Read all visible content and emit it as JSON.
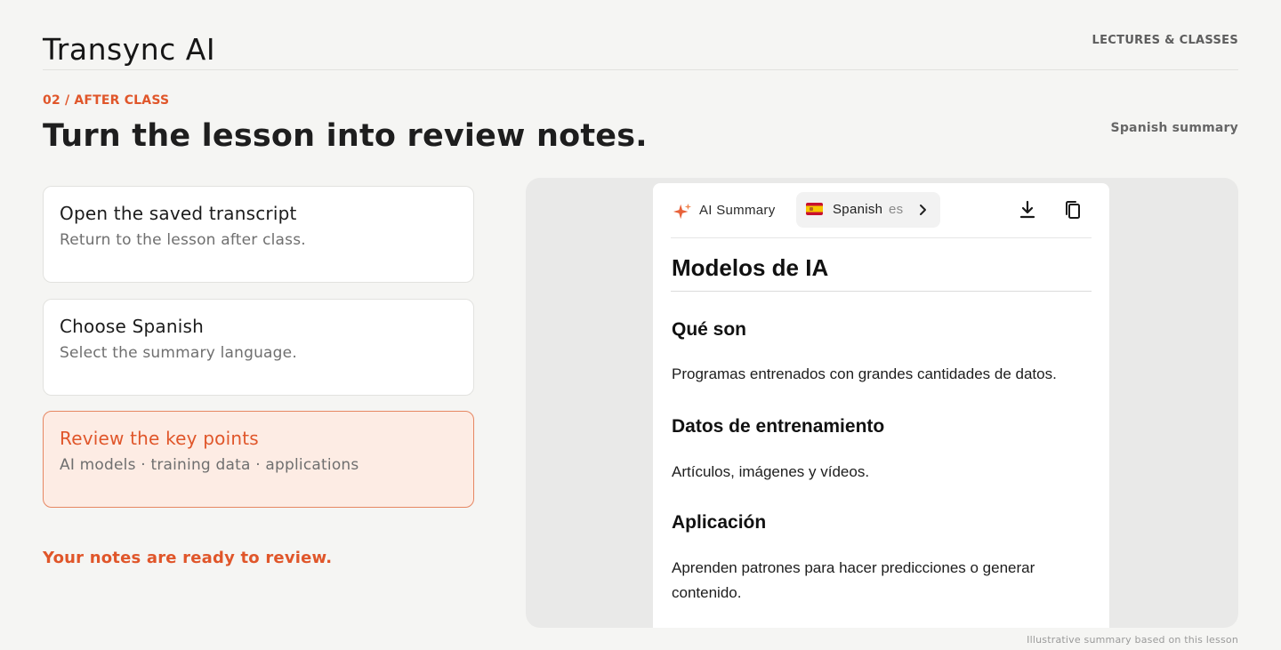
{
  "brand": {
    "name": "Transync AI"
  },
  "nav": {
    "label": "LECTURES & CLASSES"
  },
  "section": {
    "eyebrow": "02 / AFTER CLASS",
    "headline": "Turn the lesson into review notes.",
    "side_label": "Spanish summary"
  },
  "steps": [
    {
      "title": "Open the saved transcript",
      "subtitle": "Return to the lesson after class.",
      "active": false
    },
    {
      "title": "Choose Spanish",
      "subtitle": "Select the summary language.",
      "active": false
    },
    {
      "title": "Review the key points",
      "subtitle": "AI models · training data · applications",
      "active": true
    }
  ],
  "status": {
    "ready_text": "Your notes are ready to review."
  },
  "summary": {
    "toolbar": {
      "ai_label": "AI Summary",
      "language_name": "Spanish",
      "language_code": "es",
      "icons": [
        "sparkle-icon",
        "spain-flag-icon",
        "chevron-right-icon",
        "download-icon",
        "copy-icon"
      ]
    },
    "title": "Modelos de IA",
    "sections": [
      {
        "heading": "Qué son",
        "body": "Programas entrenados con grandes cantidades de datos."
      },
      {
        "heading": "Datos de entrenamiento",
        "body": "Artículos, imágenes y vídeos."
      },
      {
        "heading": "Aplicación",
        "body": "Aprenden patrones para hacer predicciones o generar contenido."
      }
    ]
  },
  "footnote": "Illustrative summary based on this lesson",
  "colors": {
    "accent": "#e0562a",
    "accent_bg": "#fdece4",
    "page_bg": "#f5f5f3",
    "preview_bg": "#e9e9e8"
  }
}
